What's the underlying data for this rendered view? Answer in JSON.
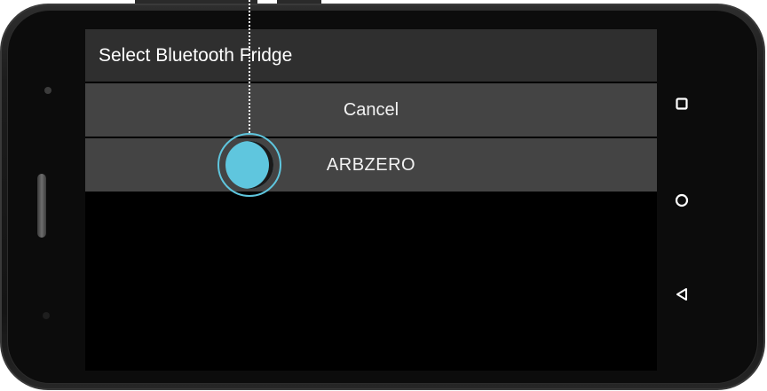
{
  "dialog": {
    "title": "Select Bluetooth Fridge",
    "items": [
      {
        "label": "Cancel"
      },
      {
        "label": "ARBZERO"
      }
    ]
  },
  "navbar": {
    "recent_icon": "square-recent-apps-icon",
    "home_icon": "circle-home-icon",
    "back_icon": "triangle-back-icon"
  },
  "tap_indicator": {
    "icon": "tap-target-icon",
    "color": "#5fc6de"
  },
  "colors": {
    "dialog_title_bg": "#2f2f2f",
    "dialog_item_bg": "#444444",
    "screen_bg": "#000000",
    "text": "#ffffff"
  }
}
